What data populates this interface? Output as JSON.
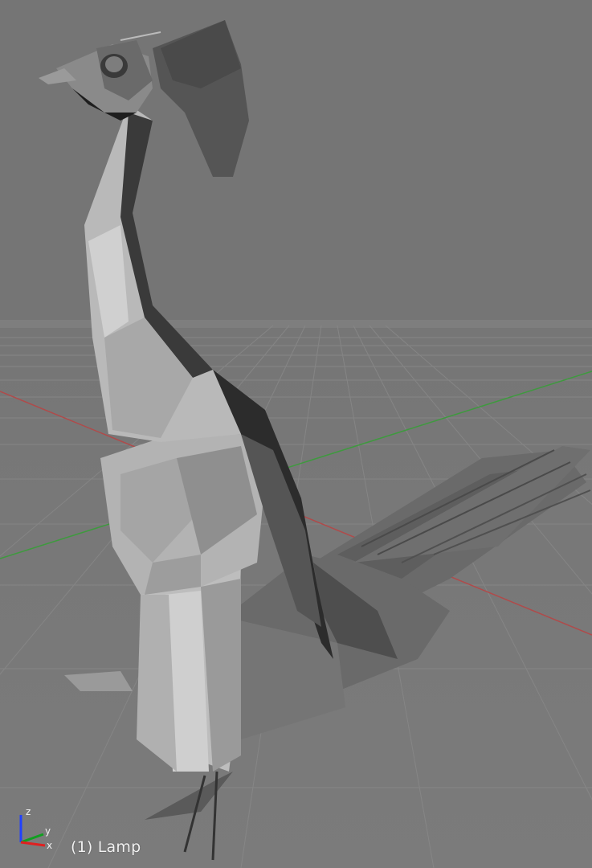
{
  "viewport": {
    "active_object_label": "(1) Lamp"
  },
  "axis_gizmo": {
    "z_label": "z",
    "y_label": "y",
    "x_label": "x",
    "colors": {
      "z": "#2040ff",
      "y": "#10a020",
      "x": "#e02020"
    }
  },
  "colors": {
    "background": "#757575",
    "grid": "#8a8a8a",
    "x_axis_line": "#b04a4a",
    "y_axis_line": "#3e9a3e"
  }
}
